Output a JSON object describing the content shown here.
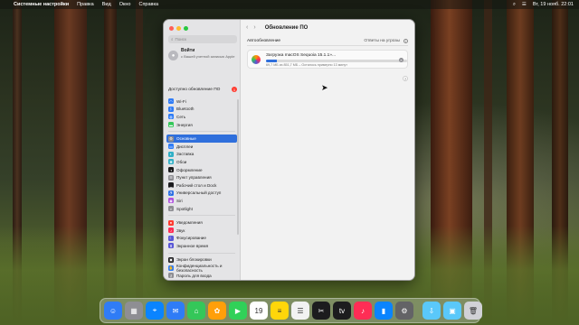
{
  "menubar": {
    "app_name": "Системные настройки",
    "menus": [
      "Правка",
      "Вид",
      "Окно",
      "Справка"
    ],
    "status": {
      "date_time": "Вт, 19 нояб.  22:01"
    }
  },
  "window": {
    "sidebar": {
      "search_placeholder": "Поиск",
      "account": {
        "title": "Войти",
        "subtitle": "с Вашей учетной записью Apple"
      },
      "software_update": {
        "label": "Доступно обновление ПО",
        "badge": "1"
      },
      "groups": [
        [
          {
            "label": "Wi-Fi",
            "icon": "wifi-icon",
            "color": "#2f7cf6"
          },
          {
            "label": "Bluetooth",
            "icon": "bluetooth-icon",
            "color": "#2f7cf6"
          },
          {
            "label": "Сеть",
            "icon": "globe-icon",
            "color": "#2f7cf6"
          },
          {
            "label": "Энергия",
            "icon": "battery-icon",
            "color": "#34c759"
          }
        ],
        [
          {
            "label": "Основные",
            "icon": "gear-icon",
            "color": "#8e8e93",
            "selected": true
          },
          {
            "label": "Дисплеи",
            "icon": "display-icon",
            "color": "#2f7cf6"
          },
          {
            "label": "Заставка",
            "icon": "screensaver-icon",
            "color": "#30b0c7"
          },
          {
            "label": "Обои",
            "icon": "wallpaper-icon",
            "color": "#30b0c7"
          },
          {
            "label": "Оформление",
            "icon": "appearance-icon",
            "color": "#1c1c1e"
          },
          {
            "label": "Пункт управления",
            "icon": "control-center-icon",
            "color": "#8e8e93"
          },
          {
            "label": "Рабочий стол и Dock",
            "icon": "dock-icon",
            "color": "#1c1c1e"
          },
          {
            "label": "Универсальный доступ",
            "icon": "accessibility-icon",
            "color": "#2f7cf6"
          },
          {
            "label": "Siri",
            "icon": "siri-icon",
            "color": "#af52de"
          },
          {
            "label": "Spotlight",
            "icon": "spotlight-icon",
            "color": "#8e8e93"
          }
        ],
        [
          {
            "label": "Уведомления",
            "icon": "bell-icon",
            "color": "#ff3b30"
          },
          {
            "label": "Звук",
            "icon": "speaker-icon",
            "color": "#ff2d55"
          },
          {
            "label": "Фокусирование",
            "icon": "moon-icon",
            "color": "#5856d6"
          },
          {
            "label": "Экранное время",
            "icon": "hourglass-icon",
            "color": "#5856d6"
          }
        ],
        [
          {
            "label": "Экран блокировки",
            "icon": "lock-icon",
            "color": "#1c1c1e"
          },
          {
            "label": "Конфиденциальность и безопасность",
            "icon": "hand-icon",
            "color": "#2f7cf6"
          },
          {
            "label": "Пароль для входа",
            "icon": "key-icon",
            "color": "#8e8e93"
          }
        ]
      ]
    },
    "main": {
      "title": "Обновление ПО",
      "auto_updates": {
        "label": "Автообновление",
        "value": "Ответы на угрозы"
      },
      "download": {
        "title": "Загрузка macOS Sequoia 15.1.1»...",
        "meta": "69,7 МБ из 851,7 МБ – Осталось примерно 13 минут",
        "progress": 0.08
      },
      "help": "?"
    }
  },
  "dock": {
    "apps": [
      {
        "name": "finder-icon",
        "color": "#2f7cf6",
        "glyph": "☺"
      },
      {
        "name": "launchpad-icon",
        "color": "#8e8e93",
        "glyph": "▦"
      },
      {
        "name": "safari-icon",
        "color": "#0a84ff",
        "glyph": "⌖"
      },
      {
        "name": "mail-icon",
        "color": "#2f7cf6",
        "glyph": "✉"
      },
      {
        "name": "maps-icon",
        "color": "#34c759",
        "glyph": "⌂"
      },
      {
        "name": "photos-icon",
        "color": "#ff9f0a",
        "glyph": "✿"
      },
      {
        "name": "facetime-icon",
        "color": "#30d158",
        "glyph": "▶"
      },
      {
        "name": "calendar-icon",
        "color": "#ffffff",
        "glyph": "19"
      },
      {
        "name": "notes-icon",
        "color": "#ffd60a",
        "glyph": "≡"
      },
      {
        "name": "reminders-icon",
        "color": "#f2f2f2",
        "glyph": "☰"
      },
      {
        "name": "finalcut-icon",
        "color": "#1c1c1e",
        "glyph": "✂"
      },
      {
        "name": "tv-icon",
        "color": "#1c1c1e",
        "glyph": "tv"
      },
      {
        "name": "music-icon",
        "color": "#ff2d55",
        "glyph": "♪"
      },
      {
        "name": "keynote-icon",
        "color": "#0a84ff",
        "glyph": "▮"
      },
      {
        "name": "system-settings-icon",
        "color": "#636366",
        "glyph": "⚙"
      },
      {
        "name": "downloads-folder-icon",
        "color": "#5ac8fa",
        "glyph": "⇩"
      },
      {
        "name": "documents-folder-icon",
        "color": "#5ac8fa",
        "glyph": "▣"
      },
      {
        "name": "trash-icon",
        "color": "#d1d1d6",
        "glyph": "🗑"
      }
    ]
  }
}
